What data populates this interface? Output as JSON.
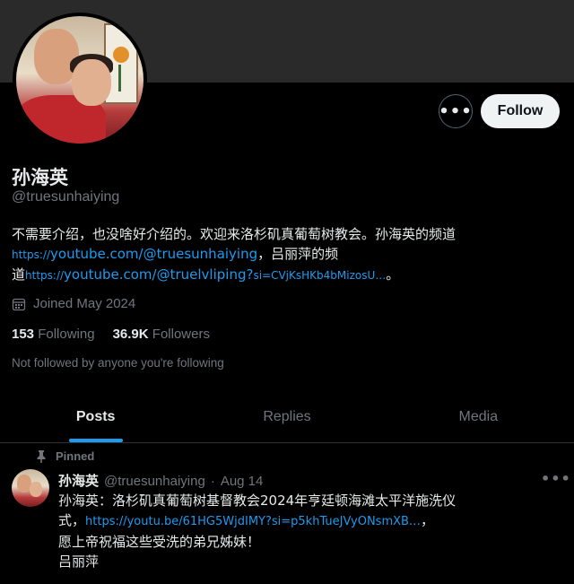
{
  "header": {
    "banner_color": "#2a2a2b"
  },
  "actions": {
    "more": "•••",
    "follow": "Follow"
  },
  "profile": {
    "name": "孙海英",
    "handle": "@truesunhaiying",
    "bio_line1": "不需要介绍，也没啥好介绍的。欢迎来洛杉矶真葡萄树教会。孙海英的频道",
    "bio_link1_prefix": "https://",
    "bio_link1": "youtube.com/@truesunhaiying",
    "bio_mid": "，吕丽萍的频",
    "bio_line3_prefix": "道",
    "bio_link2_prefix": "https://",
    "bio_link2": "youtube.com/@truelvliping?",
    "bio_link2_tail": "si=CVjKsHKb4bMizosU…",
    "bio_end": "。",
    "joined": "Joined May 2024",
    "following_count": "153",
    "following_label": "Following",
    "followers_count": "36.9K",
    "followers_label": "Followers",
    "not_followed": "Not followed by anyone you're following"
  },
  "tabs": [
    {
      "label": "Posts"
    },
    {
      "label": "Replies"
    },
    {
      "label": "Media"
    }
  ],
  "post": {
    "pinned_label": "Pinned",
    "author": "孙海英",
    "handle": "@truesunhaiying",
    "sep": "·",
    "date": "Aug 14",
    "more": "•••",
    "line1": "孙海英：洛杉矶真葡萄树基督教会2024年亨廷顿海滩太平洋施洗仪",
    "line2_prefix": "式，",
    "link": "https://youtu.be/61HG5WjdIMY?si=p5khTueJVyONsmXB…",
    "line2_suffix": "，",
    "line3": "愿上帝祝福这些受洗的弟兄姊妹！",
    "line4": "吕丽萍"
  },
  "colors": {
    "accent": "#1d9bf0",
    "muted": "#71767b",
    "text": "#e7e9ea",
    "bg": "#000000"
  }
}
